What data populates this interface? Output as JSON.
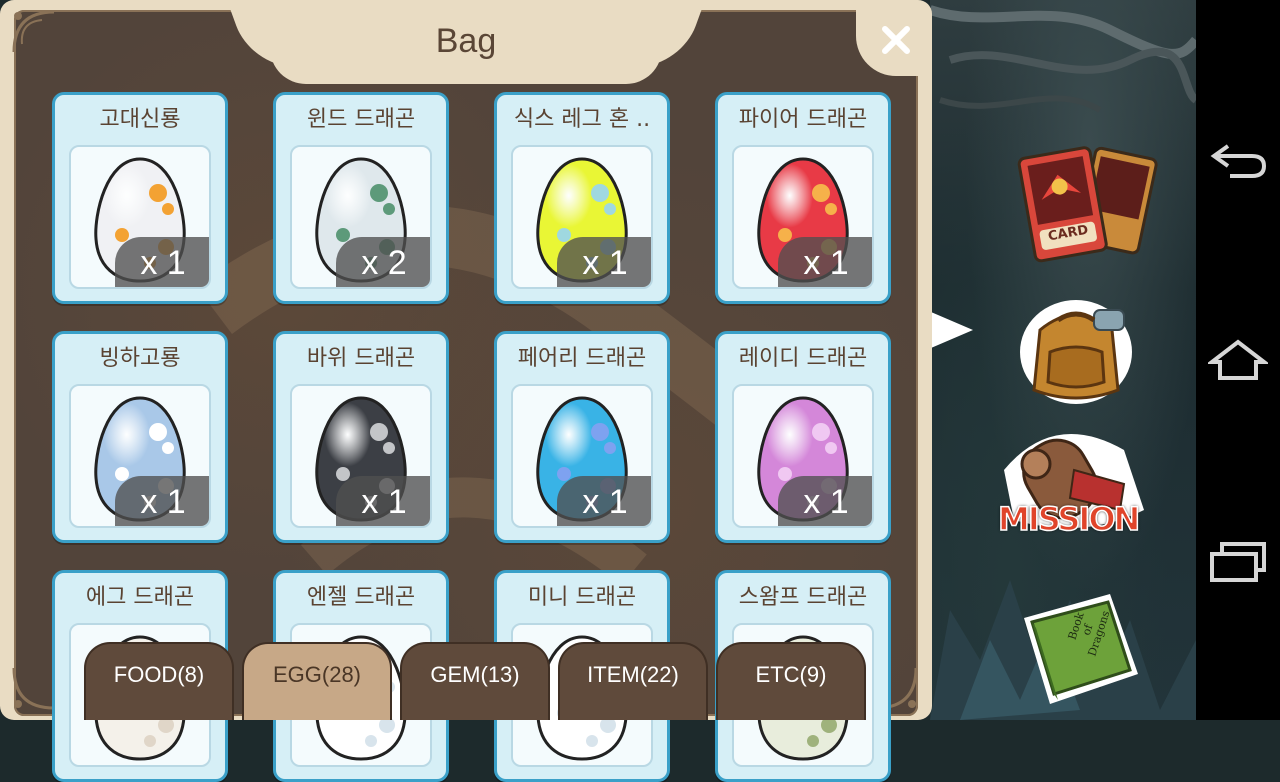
{
  "window": {
    "title": "Bag",
    "close_symbol": "✕"
  },
  "eggs": [
    {
      "name": "고대신룡",
      "qty": "x 1",
      "color": "#f0f1f4",
      "spot": "#f3a233"
    },
    {
      "name": "윈드 드래곤",
      "qty": "x 2",
      "color": "#dfe8ec",
      "spot": "#5d9a7a"
    },
    {
      "name": "식스 레그 혼 ..",
      "qty": "x 1",
      "color": "#e9f635",
      "spot": "#9fd8e0"
    },
    {
      "name": "파이어 드래곤",
      "qty": "x 1",
      "color": "#e83a46",
      "spot": "#f6b14a"
    },
    {
      "name": "빙하고룡",
      "qty": "x 1",
      "color": "#a9c8e8",
      "spot": "#ffffff"
    },
    {
      "name": "바위 드래곤",
      "qty": "x 1",
      "color": "#3c3f45",
      "spot": "#c3c5c8"
    },
    {
      "name": "페어리 드래곤",
      "qty": "x 1",
      "color": "#39b3e6",
      "spot": "#7ea2f0"
    },
    {
      "name": "레이디 드래곤",
      "qty": "x 1",
      "color": "#d487d9",
      "spot": "#f0c8f2"
    },
    {
      "name": "에그 드래곤",
      "qty": "",
      "color": "#f4f1ea",
      "spot": "#e0d6c8"
    },
    {
      "name": "엔젤 드래곤",
      "qty": "",
      "color": "#ffffff",
      "spot": "#d8e4ec"
    },
    {
      "name": "미니 드래곤",
      "qty": "",
      "color": "#ffffff",
      "spot": "#d8e4ec"
    },
    {
      "name": "스왐프 드래곤",
      "qty": "",
      "color": "#e8eddc",
      "spot": "#9fb27c"
    }
  ],
  "tabs": [
    {
      "label": "FOOD(8)",
      "active": false
    },
    {
      "label": "EGG(28)",
      "active": true
    },
    {
      "label": "GEM(13)",
      "active": false
    },
    {
      "label": "ITEM(22)",
      "active": false
    },
    {
      "label": "ETC(9)",
      "active": false
    }
  ],
  "side_menu": {
    "card_label": "CARD",
    "mission_label": "MISSION",
    "book_title_1": "Book",
    "book_title_2": "of",
    "book_title_3": "Dragons"
  },
  "colors": {
    "accent": "#3aa0c8",
    "panel": "#e9dcc3",
    "active_tab": "#c7a887"
  }
}
